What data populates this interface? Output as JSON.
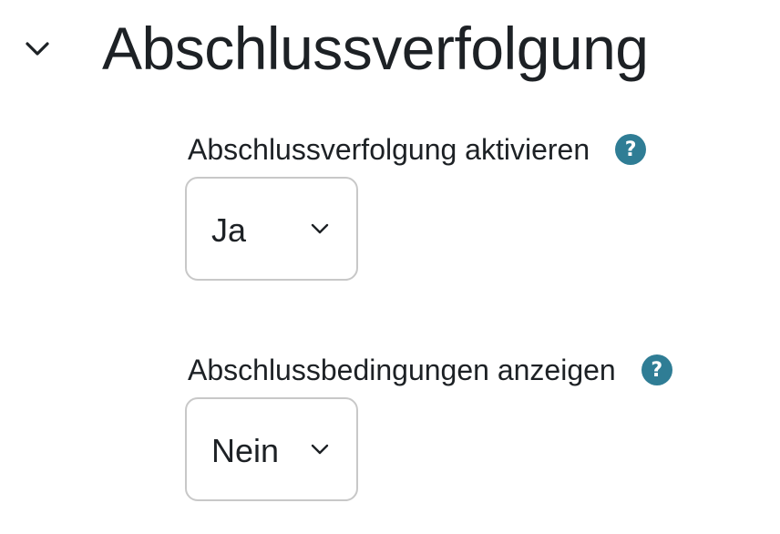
{
  "section": {
    "title": "Abschlussverfolgung",
    "toggle_icon": "chevron-down-icon"
  },
  "fields": [
    {
      "label": "Abschlussverfolgung aktivieren",
      "help_icon": "?",
      "selected_value": "Ja"
    },
    {
      "label": "Abschlussbedingungen anzeigen",
      "help_icon": "?",
      "selected_value": "Nein"
    }
  ],
  "colors": {
    "text": "#1d2125",
    "help_icon_bg": "#2f7d95",
    "select_border": "#c8c8c8"
  }
}
